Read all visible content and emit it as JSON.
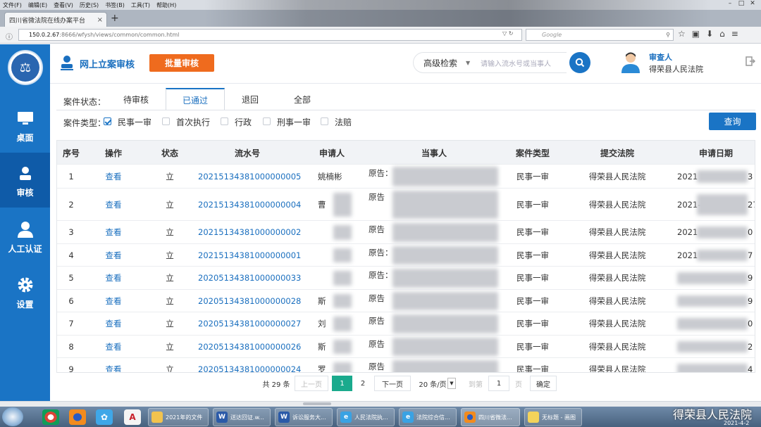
{
  "browser": {
    "menu": [
      "文件(F)",
      "编辑(E)",
      "查看(V)",
      "历史(S)",
      "书签(B)",
      "工具(T)",
      "帮助(H)"
    ],
    "tab_title": "四川省微法院在线办案平台",
    "url_host": "150.0.2.67",
    "url_rest": ":8666/wfysh/views/common/common.html",
    "search_placeholder": "Google"
  },
  "sidebar": {
    "items": [
      {
        "label": "桌面",
        "icon": "monitor-icon"
      },
      {
        "label": "审核",
        "icon": "user-icon"
      },
      {
        "label": "人工认证",
        "icon": "person-icon"
      },
      {
        "label": "设置",
        "icon": "gear-icon"
      }
    ],
    "active_index": 1
  },
  "header": {
    "title": "网上立案审核",
    "batch_button": "批量审核",
    "advanced_search": "高级检索",
    "search_placeholder": "请输入流水号或当事人",
    "user_role": "审查人",
    "user_court": "得荣县人民法院"
  },
  "filters": {
    "status_label": "案件状态：",
    "status_tabs": [
      "待审核",
      "已通过",
      "退回",
      "全部"
    ],
    "active_status": 1,
    "type_label": "案件类型：",
    "types": [
      {
        "label": "民事一审",
        "checked": true
      },
      {
        "label": "首次执行",
        "checked": false
      },
      {
        "label": "行政",
        "checked": false
      },
      {
        "label": "刑事一审",
        "checked": false
      },
      {
        "label": "法赔",
        "checked": false
      }
    ],
    "query_button": "查询"
  },
  "table": {
    "columns": [
      "序号",
      "操作",
      "状态",
      "流水号",
      "申请人",
      "当事人",
      "案件类型",
      "提交法院",
      "申请日期"
    ],
    "rows": [
      {
        "no": "1",
        "action": "查看",
        "status": "立",
        "serial": "2021513438100000000​5",
        "applicant": "姚楠彬",
        "party": "原告：",
        "type": "民事一审",
        "court": "得荣县人民法院",
        "date_prefix": "2021",
        "date_suffix": "3"
      },
      {
        "no": "2",
        "action": "查看",
        "status": "立",
        "serial": "20215134381000000004",
        "applicant": "曹",
        "party": "原告",
        "type": "民事一审",
        "court": "得荣县人民法院",
        "date_prefix": "2021-",
        "date_suffix": "27"
      },
      {
        "no": "3",
        "action": "查看",
        "status": "立",
        "serial": "20215134381000000002",
        "applicant": "",
        "party": "原告",
        "type": "民事一审",
        "court": "得荣县人民法院",
        "date_prefix": "2021",
        "date_suffix": "0"
      },
      {
        "no": "4",
        "action": "查看",
        "status": "立",
        "serial": "20215134381000000001",
        "applicant": "",
        "party": "原告：",
        "type": "民事一审",
        "court": "得荣县人民法院",
        "date_prefix": "2021",
        "date_suffix": "7"
      },
      {
        "no": "5",
        "action": "查看",
        "status": "立",
        "serial": "20205134381000000033",
        "applicant": "",
        "party": "原告：",
        "type": "民事一审",
        "court": "得荣县人民法院",
        "date_prefix": "",
        "date_suffix": "9"
      },
      {
        "no": "6",
        "action": "查看",
        "status": "立",
        "serial": "20205134381000000028",
        "applicant": "斯",
        "party": "原告",
        "type": "民事一审",
        "court": "得荣县人民法院",
        "date_prefix": "",
        "date_suffix": "9"
      },
      {
        "no": "7",
        "action": "查看",
        "status": "立",
        "serial": "20205134381000000027",
        "applicant": "刘",
        "party": "原告",
        "type": "民事一审",
        "court": "得荣县人民法院",
        "date_prefix": "",
        "date_suffix": "0"
      },
      {
        "no": "8",
        "action": "查看",
        "status": "立",
        "serial": "20205134381000000026",
        "applicant": "斯",
        "party": "原告",
        "type": "民事一审",
        "court": "得荣县人民法院",
        "date_prefix": "",
        "date_suffix": "2"
      },
      {
        "no": "9",
        "action": "查看",
        "status": "立",
        "serial": "20205134381000000024",
        "applicant": "罗",
        "party": "原告",
        "type": "民事一审",
        "court": "得荣县人民法院",
        "date_prefix": "",
        "date_suffix": "4"
      }
    ]
  },
  "pager": {
    "total": "共 29 条",
    "prev": "上一页",
    "current": "1",
    "next_page": "2",
    "next": "下一页",
    "per_page": "20 条/页",
    "goto": "到第",
    "goto_value": "1",
    "page_unit": "页",
    "confirm": "确定"
  },
  "taskbar": {
    "tasks": [
      "2021年的文件",
      "送达回证.w...",
      "诉讼服务大...",
      "人民法院执...",
      "法院综合信...",
      "四川省微法...",
      "无标题 - 画图"
    ]
  },
  "watermark": {
    "text": "得荣县人民法院",
    "date": "2021-4-2"
  }
}
